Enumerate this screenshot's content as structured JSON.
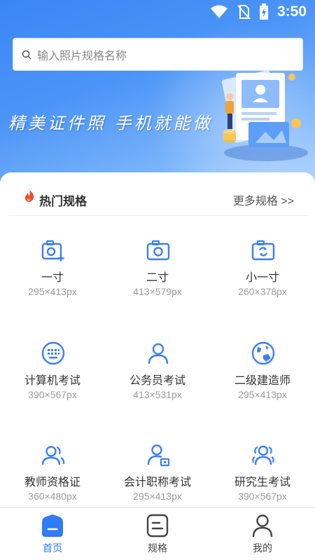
{
  "status_bar": {
    "time": "3:50"
  },
  "search": {
    "placeholder": "输入照片规格名称"
  },
  "banner": {
    "slogan": "精美证件照 手机就能做"
  },
  "hot_section": {
    "title": "热门规格",
    "more_label": "更多规格 >>"
  },
  "specs": [
    {
      "name": "一寸",
      "size": "295×413px",
      "icon": "camera-add-icon"
    },
    {
      "name": "二寸",
      "size": "413×579px",
      "icon": "camera-icon"
    },
    {
      "name": "小一寸",
      "size": "260×378px",
      "icon": "camera-switch-icon"
    },
    {
      "name": "计算机考试",
      "size": "390×567px",
      "icon": "keyboard-icon"
    },
    {
      "name": "公务员考试",
      "size": "413×531px",
      "icon": "person-icon"
    },
    {
      "name": "二级建造师",
      "size": "295×413px",
      "icon": "globe-icon"
    },
    {
      "name": "教师资格证",
      "size": "360×480px",
      "icon": "users-icon"
    },
    {
      "name": "会计职称考试",
      "size": "295×413px",
      "icon": "person-card-icon"
    },
    {
      "name": "研究生考试",
      "size": "390×567px",
      "icon": "group-icon"
    }
  ],
  "bottom_nav": [
    {
      "label": "首页",
      "icon": "home-icon",
      "active": true
    },
    {
      "label": "规格",
      "icon": "document-icon",
      "active": false
    },
    {
      "label": "我的",
      "icon": "user-icon",
      "active": false
    }
  ],
  "colors": {
    "accent": "#2f7cf4",
    "banner_top": "#3a86f5",
    "banner_bottom": "#b7d6fc"
  }
}
